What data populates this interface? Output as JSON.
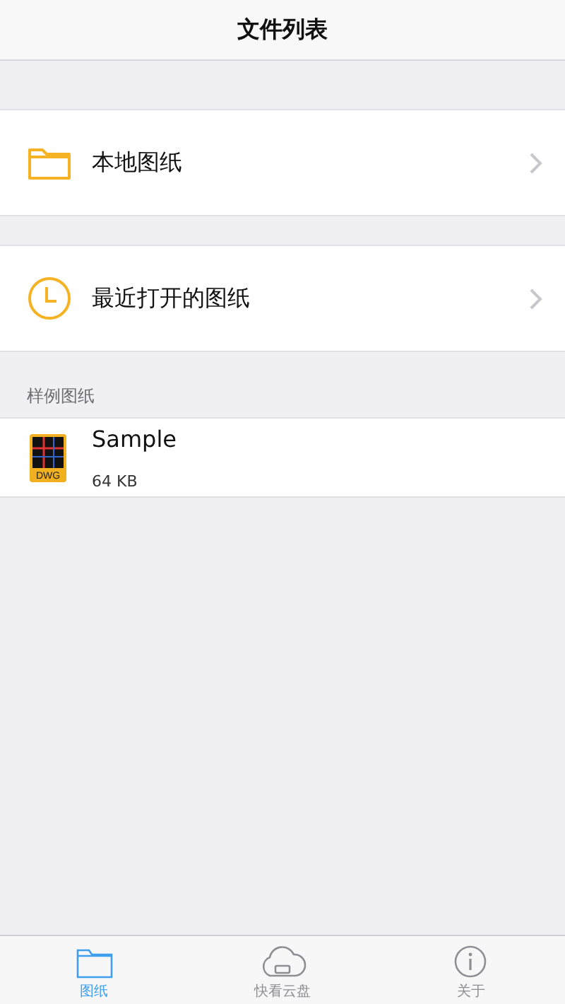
{
  "nav_bar": {
    "title": "文件列表"
  },
  "menu_items": [
    {
      "kind": "folder",
      "label": "本地图纸"
    },
    {
      "kind": "clock",
      "label": "最近打开的图纸"
    }
  ],
  "sample_section": {
    "header": "样例图纸",
    "files": [
      {
        "kind": "dwg",
        "badge": "DWG",
        "name": "Sample",
        "size": "64 KB"
      }
    ]
  },
  "tab_bar": [
    {
      "kind": "folder",
      "label": "图纸",
      "selected": true
    },
    {
      "kind": "cloud",
      "label": "快看云盘",
      "selected": false
    },
    {
      "kind": "info",
      "label": "关于",
      "selected": false
    }
  ]
}
